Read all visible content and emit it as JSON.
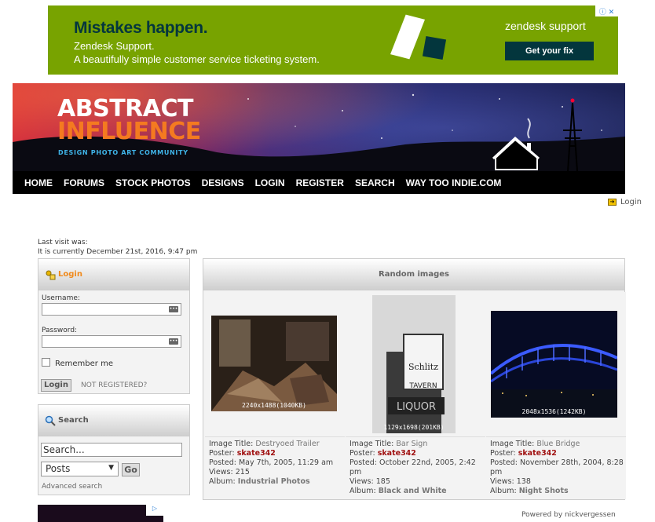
{
  "ad": {
    "headline": "Mistakes happen.",
    "line1": "Zendesk Support.",
    "line2": "A beautifully simple customer service ticketing system.",
    "brand": "zendesk support",
    "cta": "Get your fix",
    "icons": "ⓘ ✕"
  },
  "site": {
    "logo_line1": "ABSTRACT",
    "logo_line2": "INFLUENCE",
    "tagline": "DESIGN PHOTO ART COMMUNITY",
    "nav": [
      "HOME",
      "FORUMS",
      "STOCK PHOTOS",
      "DESIGNS",
      "LOGIN",
      "REGISTER",
      "SEARCH",
      "WAY TOO INDIE.COM"
    ]
  },
  "top_login": "Login",
  "visit": {
    "last": "Last visit was:",
    "current": "It is currently December 21st, 2016, 9:47 pm"
  },
  "login_block": {
    "title": "Login",
    "username_label": "Username:",
    "password_label": "Password:",
    "remember": "Remember me",
    "button": "Login",
    "not_registered": "NOT REGISTERED?"
  },
  "search_block": {
    "title": "Search",
    "placeholder": "Search...",
    "select_value": "Posts",
    "go": "Go",
    "advanced": "Advanced search"
  },
  "random": {
    "title": "Random images",
    "items": [
      {
        "dims": "2240x1488(1040KB)",
        "title_label": "Image Title:",
        "title": "Destryoed Trailer",
        "poster_label": "Poster:",
        "poster": "skate342",
        "posted_label": "Posted:",
        "posted": "May 7th, 2005, 11:29 am",
        "views_label": "Views:",
        "views": "215",
        "album_label": "Album:",
        "album": "Industrial Photos"
      },
      {
        "dims": "1129x1698(201KB)",
        "title_label": "Image Title:",
        "title": "Bar Sign",
        "poster_label": "Poster:",
        "poster": "skate342",
        "posted_label": "Posted:",
        "posted": "October 22nd, 2005, 2:42 pm",
        "views_label": "Views:",
        "views": "185",
        "album_label": "Album:",
        "album": "Black and White"
      },
      {
        "dims": "2048x1536(1242KB)",
        "title_label": "Image Title:",
        "title": "Blue Bridge",
        "poster_label": "Poster:",
        "poster": "skate342",
        "posted_label": "Posted:",
        "posted": "November 28th, 2004, 8:28 pm",
        "views_label": "Views:",
        "views": "138",
        "album_label": "Album:",
        "album": "Night Shots"
      }
    ]
  },
  "footer": {
    "powered_label": "Powered by",
    "powered_by": "nickvergessen"
  },
  "colors": {
    "ad_bg": "#78a300",
    "ad_dark": "#03363d",
    "logo_orange": "#f47a20",
    "tagline_blue": "#3fb4e8",
    "poster_red": "#a01010"
  }
}
